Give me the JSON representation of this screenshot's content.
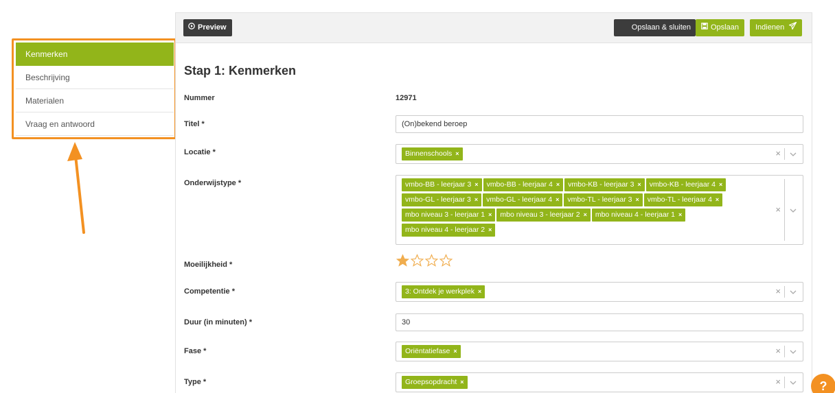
{
  "sidebar": {
    "items": [
      {
        "label": "Kenmerken",
        "active": true
      },
      {
        "label": "Beschrijving",
        "active": false
      },
      {
        "label": "Materialen",
        "active": false
      },
      {
        "label": "Vraag en antwoord",
        "active": false
      }
    ]
  },
  "toolbar": {
    "preview_label": "Preview",
    "save_close_label": "Opslaan & sluiten",
    "save_label": "Opslaan",
    "submit_label": "Indienen"
  },
  "page": {
    "title": "Stap 1: Kenmerken"
  },
  "form": {
    "nummer": {
      "label": "Nummer",
      "value": "12971"
    },
    "titel": {
      "label": "Titel",
      "required": "*",
      "value": "(On)bekend beroep"
    },
    "locatie": {
      "label": "Locatie",
      "required": "*",
      "tags": [
        "Binnenschools"
      ]
    },
    "onderwijstype": {
      "label": "Onderwijstype",
      "required": "*",
      "tags": [
        "vmbo-BB - leerjaar 3",
        "vmbo-BB - leerjaar 4",
        "vmbo-KB - leerjaar 3",
        "vmbo-KB - leerjaar 4",
        "vmbo-GL - leerjaar 3",
        "vmbo-GL - leerjaar 4",
        "vmbo-TL - leerjaar 3",
        "vmbo-TL - leerjaar 4",
        "mbo niveau 3 - leerjaar 1",
        "mbo niveau 3 - leerjaar 2",
        "mbo niveau 4 - leerjaar 1",
        "mbo niveau 4 - leerjaar 2"
      ]
    },
    "moeilijkheid": {
      "label": "Moeilijkheid",
      "required": "*",
      "rating": 1,
      "max": 4
    },
    "competentie": {
      "label": "Competentie",
      "required": "*",
      "tags": [
        "3: Ontdek je werkplek"
      ]
    },
    "duur": {
      "label": "Duur (in minuten)",
      "required": "*",
      "value": "30"
    },
    "fase": {
      "label": "Fase",
      "required": "*",
      "tags": [
        "Oriëntatiefase"
      ]
    },
    "type": {
      "label": "Type",
      "required": "*",
      "tags": [
        "Groepsopdracht"
      ]
    }
  },
  "tag_remove": "×",
  "clear_symbol": "×",
  "help": {
    "label": "?"
  },
  "colors": {
    "accent": "#92b51a",
    "dark": "#3c3c3c",
    "highlight": "#f39122",
    "star": "#f0ad4e"
  },
  "icons": {
    "preview": "play-circle-icon",
    "save": "floppy-disk-icon",
    "submit": "paper-plane-icon",
    "clear": "clear-x-icon",
    "dropdown": "chevron-down-icon",
    "star": "star-icon",
    "arrow": "up-arrow-annotation"
  }
}
